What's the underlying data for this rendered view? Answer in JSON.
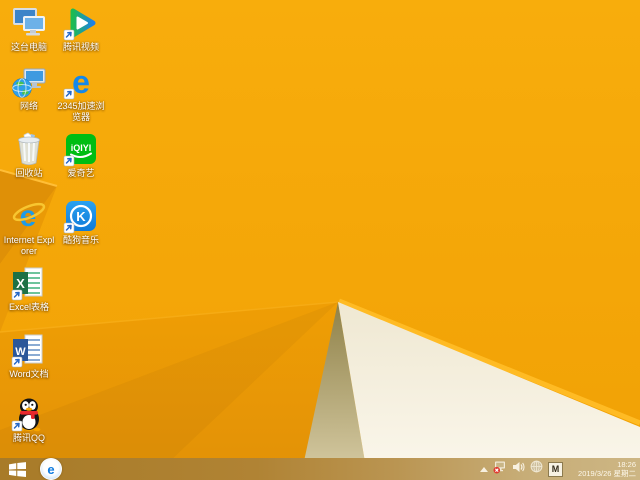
{
  "colors": {
    "wallpaper_orange": "#f2a307",
    "wallpaper_facet_dark": "#df9007",
    "wallpaper_cream": "#f5efdd",
    "wallpaper_olive": "#9c8d52",
    "highlight_edge": "#ffbb24",
    "taskbar_tan": "#b78f46",
    "accent_blue": "#1b7fd9"
  },
  "desktop": {
    "icons": [
      {
        "label": "这台电脑"
      },
      {
        "label": "腾讯视频"
      },
      {
        "label": "网络"
      },
      {
        "label": "2345加速浏览器"
      },
      {
        "label": "回收站"
      },
      {
        "label": "爱奇艺"
      },
      {
        "label": "Internet Explorer"
      },
      {
        "label": "酷狗音乐"
      },
      {
        "label": "Excel表格"
      },
      {
        "label": "Word文档"
      },
      {
        "label": "腾讯QQ"
      }
    ]
  },
  "artwork": {
    "ie_letter": "e",
    "browser_letter": "e",
    "iqiyi_text": "iQIYI",
    "kugou_letter": "K",
    "excel_letter": "X",
    "word_letter": "W",
    "taskbar_browser_letter": "e"
  },
  "taskbar": {
    "tray": {
      "input_indicator": "M",
      "clock_time": "18:26",
      "clock_date": "2019/3/26 星期二"
    }
  }
}
